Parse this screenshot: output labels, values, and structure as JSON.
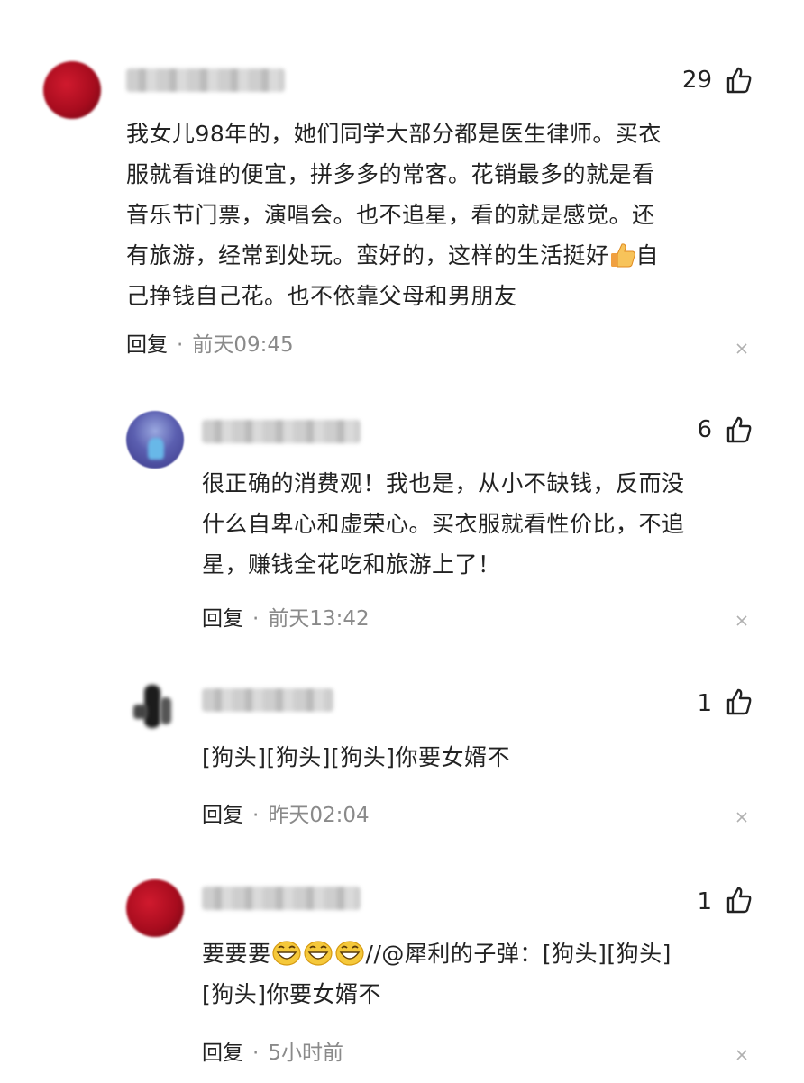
{
  "comments": [
    {
      "likes": "29",
      "text_parts": [
        "我女儿98年的，她们同学大部分都是医生律师。买衣服就看谁的便宜，拼多多的常客。花销最多的就是看音乐节门票，演唱会。也不追星，看的就是感觉。还有旅游，经常到处玩。蛮好的，这样的生活挺好",
        "自己挣钱自己花。也不依靠父母和男朋友"
      ],
      "line1": "我女儿98年的，她们同学大部分都是医生律师。买衣",
      "line2": "服就看谁的便宜，拼多多的常客。花销最多的就是看",
      "line3": "音乐节门票，演唱会。也不追星，看的就是感觉。还",
      "line4a": "有旅游，经常到处玩。蛮好的，这样的生活挺好",
      "line4b": "自",
      "line5": "己挣钱自己花。也不依靠父母和男朋友",
      "reply_label": "回复",
      "dot": "·",
      "time": "前天09:45"
    },
    {
      "likes": "6",
      "line1": "很正确的消费观！我也是，从小不缺钱，反而没",
      "line2": "什么自卑心和虚荣心。买衣服就看性价比，不追",
      "line3": "星，赚钱全花吃和旅游上了！",
      "reply_label": "回复",
      "dot": "·",
      "time": "前天13:42"
    },
    {
      "likes": "1",
      "line1": "[狗头][狗头][狗头]你要女婿不",
      "reply_label": "回复",
      "dot": "·",
      "time": "昨天02:04"
    },
    {
      "likes": "1",
      "line1a": "要要要",
      "line1b": "//@犀利的子弹：[狗头][狗头]",
      "line2": "[狗头]你要女婿不",
      "reply_label": "回复",
      "dot": "·",
      "time": "5小时前"
    }
  ],
  "icons": {
    "like": "thumbs-up-outline-icon",
    "close": "close-icon",
    "thumb_emoji": "thumbs-up-emoji",
    "grin_emoji": "grinning-face-emoji"
  },
  "colors": {
    "text": "#222222",
    "time": "#8a8a8a",
    "close": "#b0b0b0"
  }
}
